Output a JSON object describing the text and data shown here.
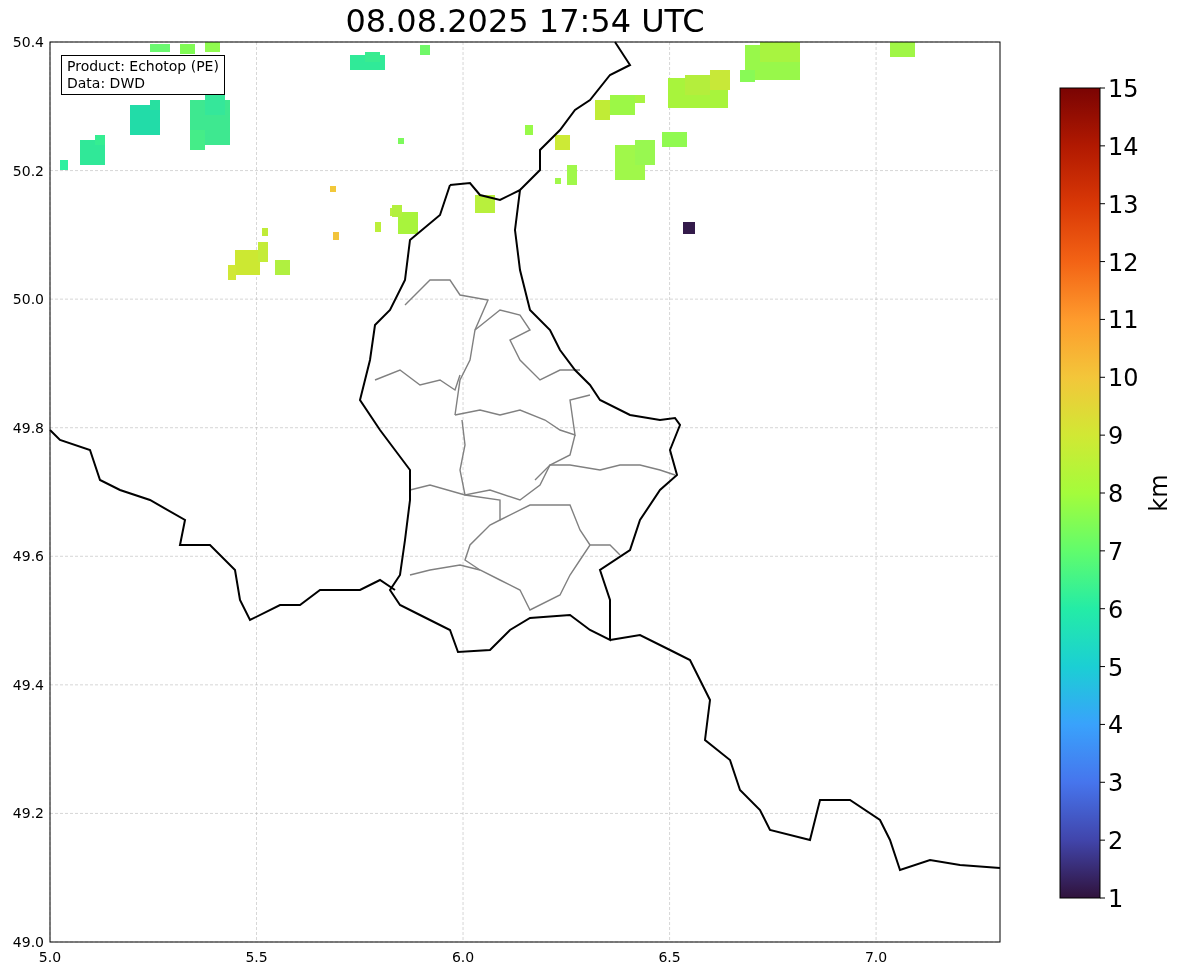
{
  "title": "08.08.2025 17:54 UTC",
  "info_box": [
    "Product: Echotop (PE)",
    "Data: DWD"
  ],
  "x_ticks": [
    "5.0",
    "5.5",
    "6.0",
    "6.5",
    "7.0"
  ],
  "y_ticks": [
    "50.4",
    "50.2",
    "50.0",
    "49.8",
    "49.6",
    "49.4",
    "49.2",
    "49.0"
  ],
  "colorbar": {
    "label": "km",
    "ticks": [
      "15",
      "14",
      "13",
      "12",
      "11",
      "10",
      "9",
      "8",
      "7",
      "6",
      "5",
      "4",
      "3",
      "2",
      "1"
    ]
  }
}
